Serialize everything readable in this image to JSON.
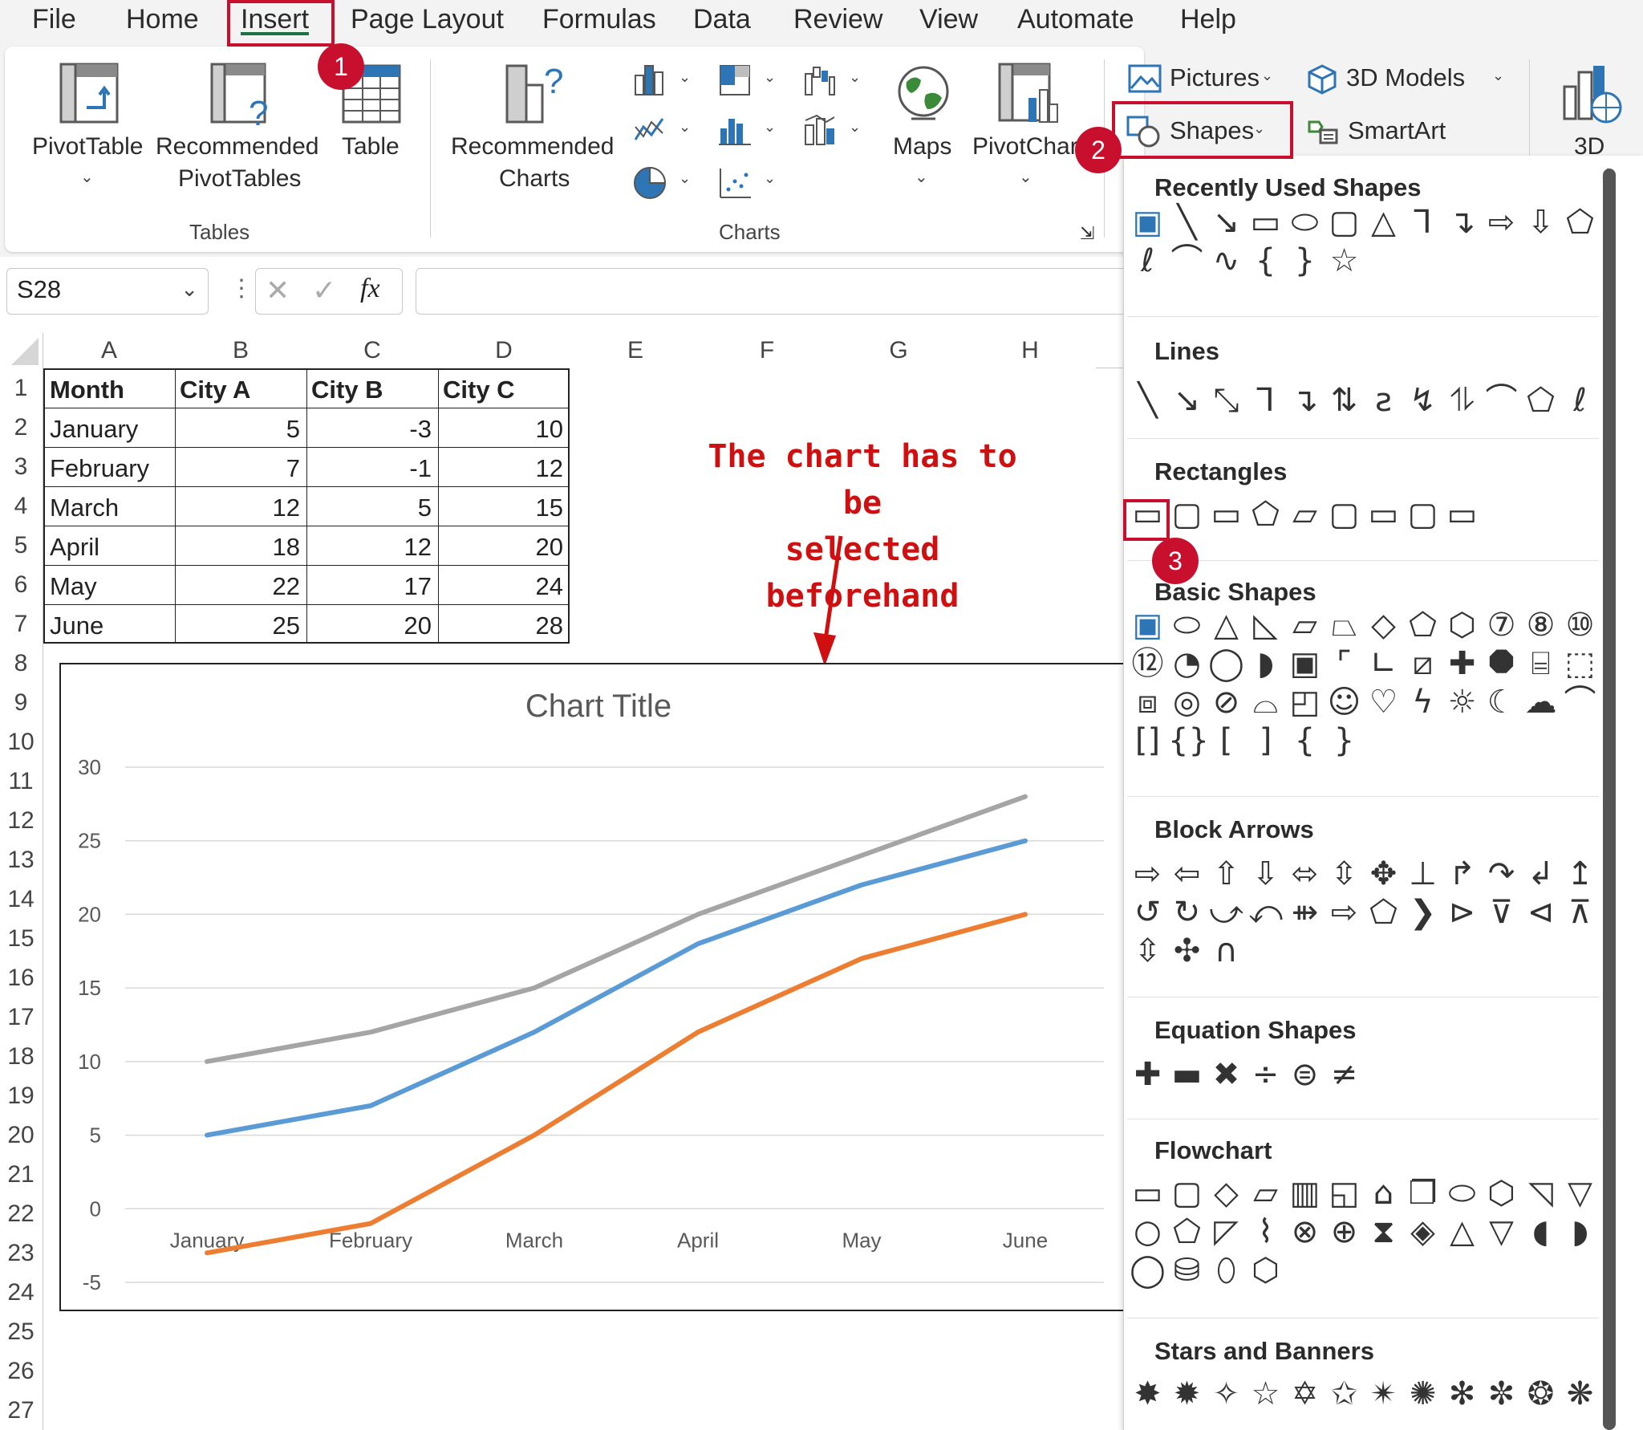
{
  "menu": [
    "File",
    "Home",
    "Insert",
    "Page Layout",
    "Formulas",
    "Data",
    "Review",
    "View",
    "Automate",
    "Help"
  ],
  "ribbon": {
    "pivottable": "PivotTable",
    "recommended_pivot_1": "Recommended",
    "recommended_pivot_2": "PivotTables",
    "table": "Table",
    "tables_group": "Tables",
    "recommended_charts_1": "Recommended",
    "recommended_charts_2": "Charts",
    "charts_group": "Charts",
    "maps": "Maps",
    "pivotchart": "PivotChar",
    "pictures": "Pictures",
    "shapes": "Shapes",
    "models_3d": "3D Models",
    "smartart": "SmartArt",
    "label_3d": "3D"
  },
  "formula_bar": {
    "name_box": "S28",
    "fx": "fx",
    "value": ""
  },
  "columns": [
    "A",
    "B",
    "C",
    "D",
    "E",
    "F",
    "G",
    "H"
  ],
  "rows": [
    "1",
    "2",
    "3",
    "4",
    "5",
    "6",
    "7",
    "8",
    "9",
    "10",
    "11",
    "12",
    "13",
    "14",
    "15",
    "16",
    "17",
    "18",
    "19",
    "20",
    "21",
    "22",
    "23",
    "24",
    "25",
    "26",
    "27"
  ],
  "table": {
    "headers": [
      "Month",
      "City A",
      "City B",
      "City C"
    ],
    "data": [
      [
        "January",
        "5",
        "-3",
        "10"
      ],
      [
        "February",
        "7",
        "-1",
        "12"
      ],
      [
        "March",
        "12",
        "5",
        "15"
      ],
      [
        "April",
        "18",
        "12",
        "20"
      ],
      [
        "May",
        "22",
        "17",
        "24"
      ],
      [
        "June",
        "25",
        "20",
        "28"
      ]
    ]
  },
  "annotation": {
    "line1": "The chart has to be",
    "line2": "selected beforehand"
  },
  "chart_data": {
    "type": "line",
    "title": "Chart Title",
    "categories": [
      "January",
      "February",
      "March",
      "April",
      "May",
      "June"
    ],
    "series": [
      {
        "values": [
          5,
          7,
          12,
          18,
          22,
          25
        ],
        "color": "#5b9bd5"
      },
      {
        "values": [
          -3,
          -1,
          5,
          12,
          17,
          20
        ],
        "color": "#ed7d31"
      },
      {
        "values": [
          10,
          12,
          15,
          20,
          24,
          28
        ],
        "color": "#a5a5a5"
      }
    ],
    "yticks": [
      "30",
      "25",
      "20",
      "15",
      "10",
      "5",
      "0",
      "-5"
    ],
    "ylim": [
      -5,
      30
    ],
    "grid": true,
    "xlabel": "",
    "ylabel": ""
  },
  "shapes_menu": {
    "recent": "Recently Used Shapes",
    "lines": "Lines",
    "rectangles": "Rectangles",
    "basic": "Basic Shapes",
    "block_arrows": "Block Arrows",
    "equation": "Equation Shapes",
    "flowchart": "Flowchart",
    "stars": "Stars and Banners"
  },
  "badges": [
    "1",
    "2",
    "3"
  ],
  "colors": {
    "highlight": "#c8102e",
    "annotation": "#d01010"
  }
}
